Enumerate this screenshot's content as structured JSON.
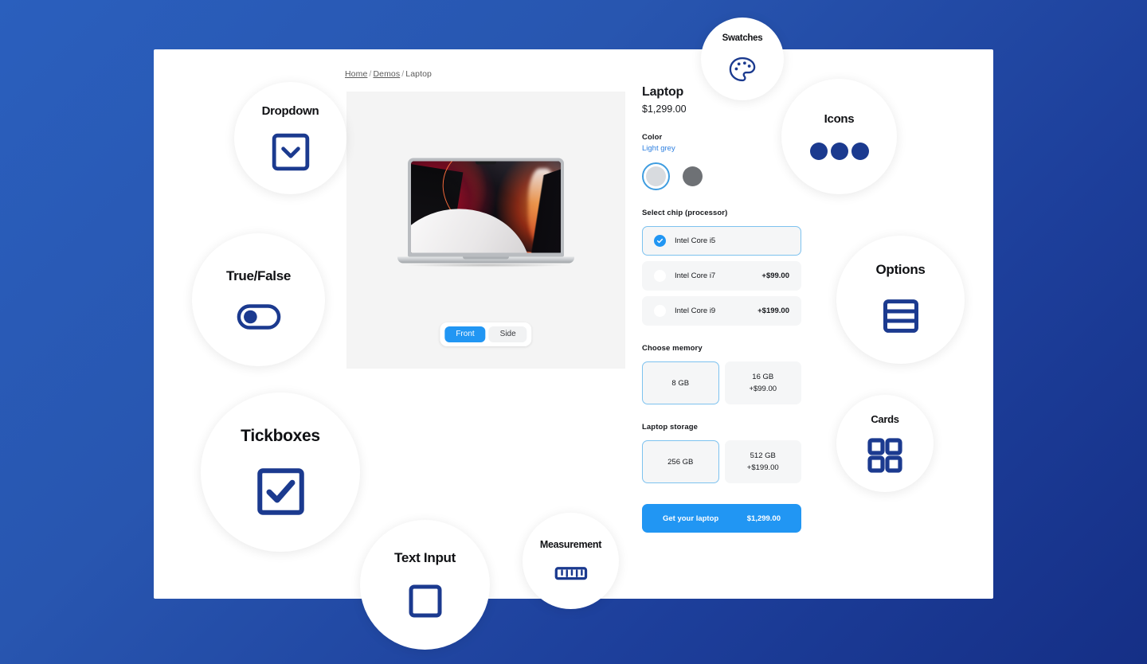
{
  "theme": {
    "background_gradient_from": "#2a5fbd",
    "background_gradient_to": "#152f86",
    "accent_blue": "#2196f3",
    "link_blue": "#2f80e0",
    "icon_navy": "#1b3a8f",
    "panel_bg": "#ffffff",
    "tile_bg": "#f5f6f7",
    "media_bg": "#f4f4f4"
  },
  "breadcrumb": {
    "home": "Home",
    "demos": "Demos",
    "current": "Laptop",
    "separator": "/"
  },
  "product": {
    "title": "Laptop",
    "price": "$1,299.00"
  },
  "media": {
    "view_toggle": [
      {
        "label": "Front",
        "active": true
      },
      {
        "label": "Side",
        "active": false
      }
    ]
  },
  "color": {
    "label": "Color",
    "selected_value": "Light grey",
    "swatches": [
      {
        "name": "Light grey",
        "hex": "#d8dbdf",
        "selected": true
      },
      {
        "name": "Space grey",
        "hex": "#6e7175",
        "selected": false
      }
    ]
  },
  "chip": {
    "label": "Select chip (processor)",
    "options": [
      {
        "label": "Intel Core i5",
        "extra": "",
        "selected": true
      },
      {
        "label": "Intel Core i7",
        "extra": "+$99.00",
        "selected": false
      },
      {
        "label": "Intel Core i9",
        "extra": "+$199.00",
        "selected": false
      }
    ]
  },
  "memory": {
    "label": "Choose memory",
    "options": [
      {
        "main": "8 GB",
        "extra": "",
        "selected": true
      },
      {
        "main": "16 GB",
        "extra": "+$99.00",
        "selected": false
      }
    ]
  },
  "storage": {
    "label": "Laptop storage",
    "options": [
      {
        "main": "256 GB",
        "extra": "",
        "selected": true
      },
      {
        "main": "512 GB",
        "extra": "+$199.00",
        "selected": false
      }
    ]
  },
  "cta": {
    "label": "Get your laptop",
    "price": "$1,299.00"
  },
  "bubbles": [
    {
      "id": "dropdown",
      "label": "Dropdown",
      "icon": "chevron-down-box-icon"
    },
    {
      "id": "truefalse",
      "label": "True/False",
      "icon": "toggle-switch-icon"
    },
    {
      "id": "tickboxes",
      "label": "Tickboxes",
      "icon": "checkbox-checked-icon"
    },
    {
      "id": "textinput",
      "label": "Text Input",
      "icon": "input-box-icon"
    },
    {
      "id": "measurement",
      "label": "Measurement",
      "icon": "ruler-icon"
    },
    {
      "id": "swatches",
      "label": "Swatches",
      "icon": "palette-icon"
    },
    {
      "id": "icons",
      "label": "Icons",
      "icon": "three-dots-icon"
    },
    {
      "id": "options",
      "label": "Options",
      "icon": "list-rows-icon"
    },
    {
      "id": "cards",
      "label": "Cards",
      "icon": "grid-four-icon"
    }
  ]
}
